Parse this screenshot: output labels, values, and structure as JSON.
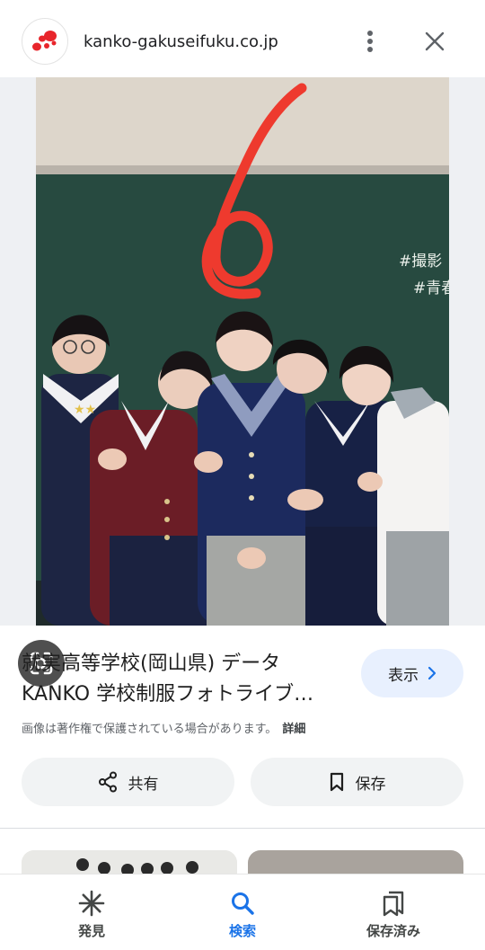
{
  "header": {
    "domain": "kanko-gakuseifuku.co.jp",
    "logo_icon": "kanko-logo-icon",
    "more_icon": "more-vert-icon",
    "close_icon": "close-icon"
  },
  "result": {
    "title": "就実高等学校(岡山県) データ KANKO 学校制服フォトライブ…",
    "visit_label": "表示",
    "copyright_note": "画像は著作権で保護されている場合があります。",
    "details_label": "詳細",
    "share_label": "共有",
    "save_label": "保存"
  },
  "photo": {
    "board_text_1": "#撮影",
    "board_text_2": "#青春"
  },
  "bottom_nav": {
    "items": [
      {
        "label": "発見",
        "icon": "asterisk-icon",
        "active": false
      },
      {
        "label": "検索",
        "icon": "search-icon",
        "active": true
      },
      {
        "label": "保存済み",
        "icon": "collections-icon",
        "active": false
      }
    ]
  },
  "colors": {
    "accent": "#1a73e8",
    "visit_button_bg": "#e8f0fe",
    "action_button_bg": "#f1f3f4",
    "logo_red": "#e8252b",
    "chalkboard": "#274a40",
    "red_drawing": "#ee3a2e"
  }
}
